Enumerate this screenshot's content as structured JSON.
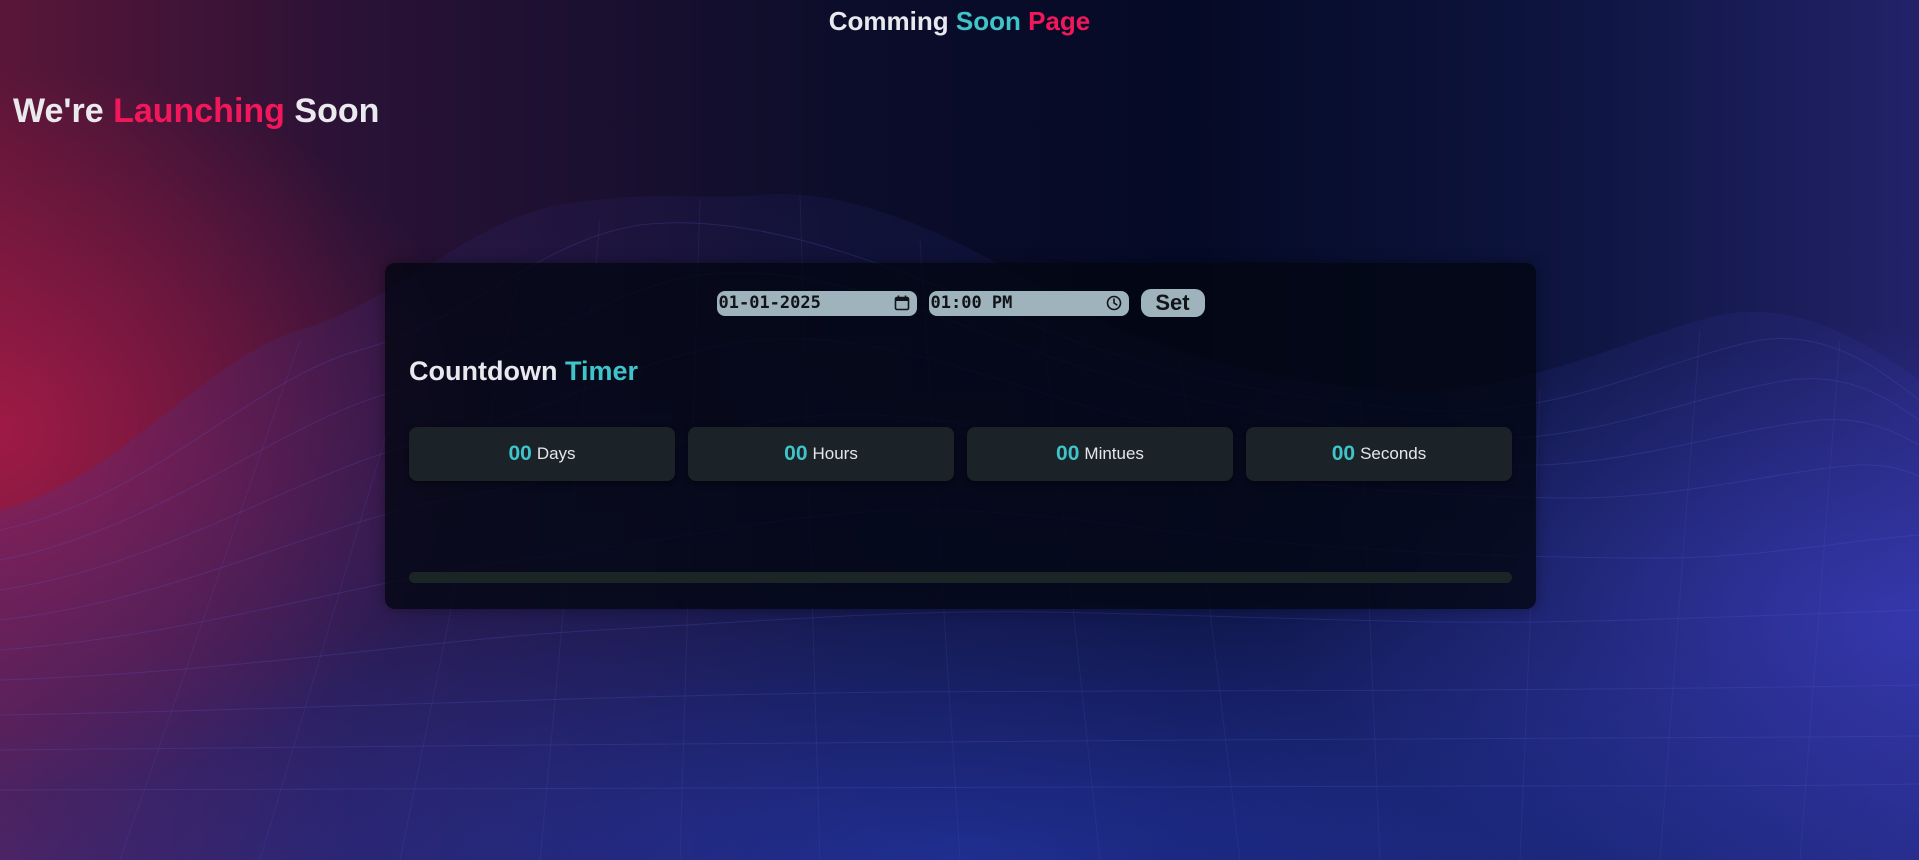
{
  "header": {
    "title_part1": "Comming ",
    "title_part2": "Soon ",
    "title_part3": "Page"
  },
  "hero": {
    "part1": "We're ",
    "part2": "Launching",
    "part3": " Soon"
  },
  "controls": {
    "date_value": "01-01-2025",
    "time_value": "01:00 PM",
    "set_label": "Set",
    "date_icon": "calendar-icon",
    "time_icon": "clock-icon"
  },
  "timer": {
    "title_part1": "Countdown ",
    "title_part2": "Timer",
    "units": [
      {
        "value": "00",
        "label": "Days"
      },
      {
        "value": "00",
        "label": "Hours"
      },
      {
        "value": "00",
        "label": "Mintues"
      },
      {
        "value": "00",
        "label": "Seconds"
      }
    ],
    "progress_fraction": 0
  },
  "colors": {
    "accent_cyan": "#3fc4c9",
    "accent_pink": "#f2175a",
    "card_bg": "#03061280",
    "input_bg": "#9fb3bd"
  }
}
